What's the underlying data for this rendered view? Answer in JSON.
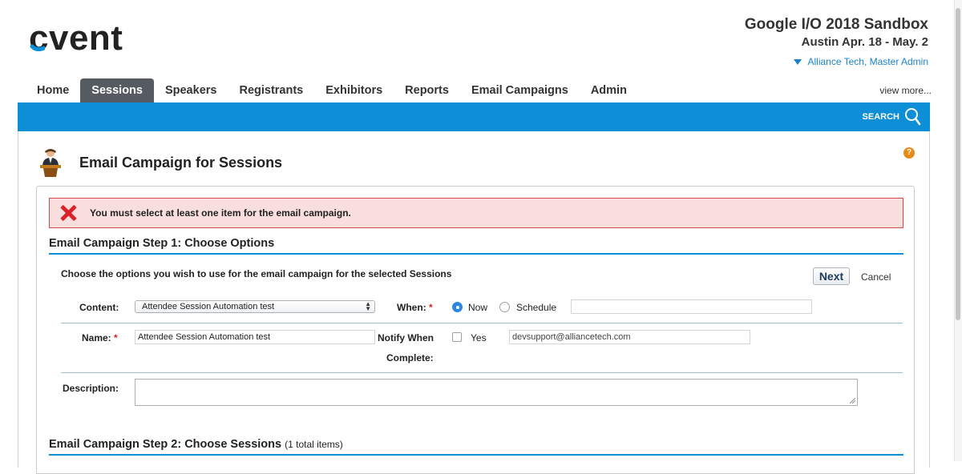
{
  "header": {
    "logo_text": "cvent",
    "event_title": "Google I/O 2018 Sandbox",
    "event_dates": "Austin Apr. 18 - May. 2",
    "account": "Alliance Tech, Master Admin"
  },
  "nav": {
    "tabs": [
      {
        "label": "Home",
        "active": false
      },
      {
        "label": "Sessions",
        "active": true
      },
      {
        "label": "Speakers",
        "active": false
      },
      {
        "label": "Registrants",
        "active": false
      },
      {
        "label": "Exhibitors",
        "active": false
      },
      {
        "label": "Reports",
        "active": false
      },
      {
        "label": "Email Campaigns",
        "active": false
      },
      {
        "label": "Admin",
        "active": false
      }
    ],
    "view_more": "view more..."
  },
  "toolbar": {
    "search_label": "SEARCH"
  },
  "page": {
    "title": "Email Campaign for Sessions",
    "help": "?"
  },
  "error": {
    "message": "You must select at least one item for the email campaign."
  },
  "step1": {
    "title": "Email Campaign Step 1: Choose Options",
    "instructions": "Choose the options you wish to use for the email campaign for the selected Sessions",
    "next_label": "Next",
    "cancel_label": "Cancel",
    "content_label": "Content:",
    "content_value": "Attendee Session Automation test",
    "when_label": "When:",
    "required_mark": "*",
    "when_options": {
      "now": "Now",
      "schedule": "Schedule",
      "selected": "Now"
    },
    "schedule_value": "",
    "name_label": "Name:",
    "name_value": "Attendee Session Automation test",
    "notify_label_1": "Notify When",
    "notify_label_2": "Complete:",
    "notify_yes": "Yes",
    "notify_email": "devsupport@alliancetech.com",
    "description_label": "Description:",
    "description_value": ""
  },
  "step2": {
    "title": "Email Campaign Step 2: Choose Sessions",
    "count": "(1 total items)"
  },
  "colors": {
    "accent_blue": "#0c8fd6",
    "error_red": "#d9232a",
    "link_blue": "#1a82c8"
  }
}
